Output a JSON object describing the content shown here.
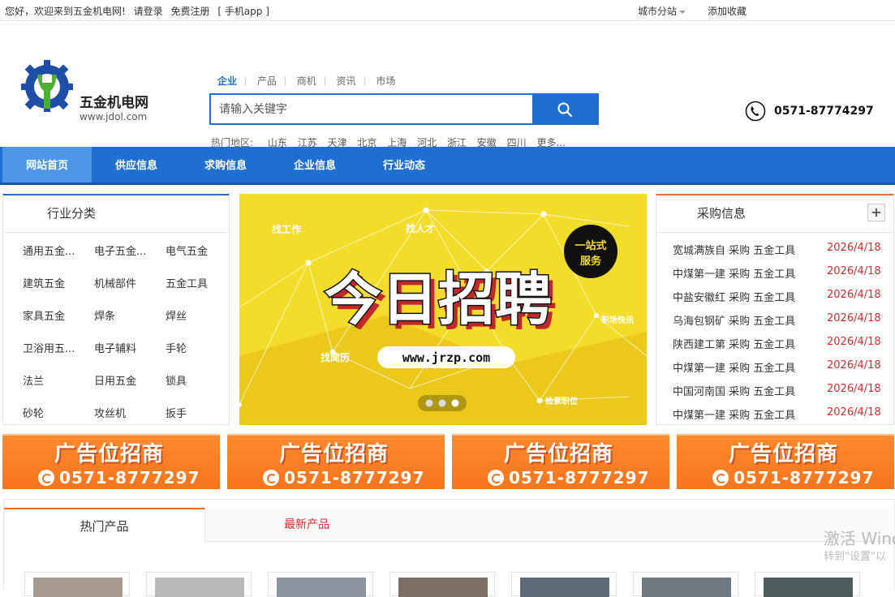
{
  "topbar": {
    "welcome": "您好，欢迎来到五金机电网!",
    "login": "请登录",
    "register": "免费注册",
    "app": "[ 手机app ]",
    "city": "城市分站",
    "favorite": "添加收藏"
  },
  "brand": {
    "name": "五金机电网",
    "url": "www.jdol.com"
  },
  "search": {
    "tabs": [
      "企业",
      "产品",
      "商机",
      "资讯",
      "市场"
    ],
    "active_tab": "企业",
    "placeholder": "请输入关键字",
    "hot_label": "热门地区:",
    "hot_areas": [
      "山东",
      "江苏",
      "天津",
      "北京",
      "上海",
      "河北",
      "浙江",
      "安徽",
      "四川",
      "更多..."
    ]
  },
  "phone": "0571-87774297",
  "nav": [
    "网站首页",
    "供应信息",
    "求购信息",
    "企业信息",
    "行业动态"
  ],
  "categories": {
    "title": "行业分类",
    "items": [
      "通用五金...",
      "电子五金...",
      "电气五金",
      "建筑五金",
      "机械部件",
      "五金工具",
      "家具五金",
      "焊条",
      "焊丝",
      "卫浴用五...",
      "电子辅料",
      "手轮",
      "法兰",
      "日用五金",
      "锁具",
      "砂轮",
      "攻丝机",
      "扳手"
    ]
  },
  "banner": {
    "headline": "今日招聘",
    "badge_line1": "一站式",
    "badge_line2": "服务",
    "url": "www.jrzp.com",
    "tags": [
      "找工作",
      "找人才",
      "找简历",
      "职场快讯",
      "检索职位"
    ]
  },
  "purchase": {
    "title": "采购信息",
    "rows": [
      {
        "text": "宽城满族自 采购 五金工具",
        "date": "2026/4/18"
      },
      {
        "text": "中煤第一建 采购 五金工具",
        "date": "2026/4/18"
      },
      {
        "text": "中盐安徽红 采购 五金工具",
        "date": "2026/4/18"
      },
      {
        "text": "乌海包钢矿 采购 五金工具",
        "date": "2026/4/18"
      },
      {
        "text": "陕西建工第 采购 五金工具",
        "date": "2026/4/18"
      },
      {
        "text": "中煤第一建 采购 五金工具",
        "date": "2026/4/18"
      },
      {
        "text": "中国河南国 采购 五金工具",
        "date": "2026/4/18"
      },
      {
        "text": "中煤第一建 采购 五金工具",
        "date": "2026/4/18"
      }
    ]
  },
  "ads": [
    {
      "title": "广告位招商",
      "tel": "0571-8777297"
    },
    {
      "title": "广告位招商",
      "tel": "0571-8777297"
    },
    {
      "title": "广告位招商",
      "tel": "0571-8777297"
    },
    {
      "title": "广告位招商",
      "tel": "0571-8777297"
    }
  ],
  "products": {
    "tab_hot": "热门产品",
    "tab_new": "最新产品"
  },
  "watermark": {
    "line1": "激活 Wind",
    "line2": "转到\"设置\"以"
  }
}
